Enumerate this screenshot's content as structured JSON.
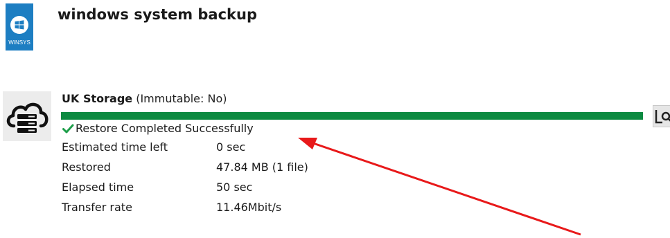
{
  "header": {
    "title": "windows system backup",
    "logo_text": "WINSYS",
    "logo_icon": "windows-logo-icon",
    "logo_color": "#1d7ec2"
  },
  "destination": {
    "name": "UK Storage",
    "immutable_text": "(Immutable: No)",
    "icon": "cloud-storage-icon",
    "progress": 1.0,
    "progress_color": "#0c8a41",
    "status_icon": "check-icon",
    "status_color": "#1e9e4a",
    "status_text": "Restore Completed Successfully",
    "stats": [
      {
        "label": "Estimated time left",
        "value": "0 sec"
      },
      {
        "label": "Restored",
        "value": "47.84 MB (1 file)"
      },
      {
        "label": "Elapsed time",
        "value": "50 sec"
      },
      {
        "label": "Transfer rate",
        "value": "11.46Mbit/s"
      }
    ],
    "side_button_icon": "log-view-icon"
  },
  "annotation": {
    "arrow_color": "#e8191a"
  }
}
